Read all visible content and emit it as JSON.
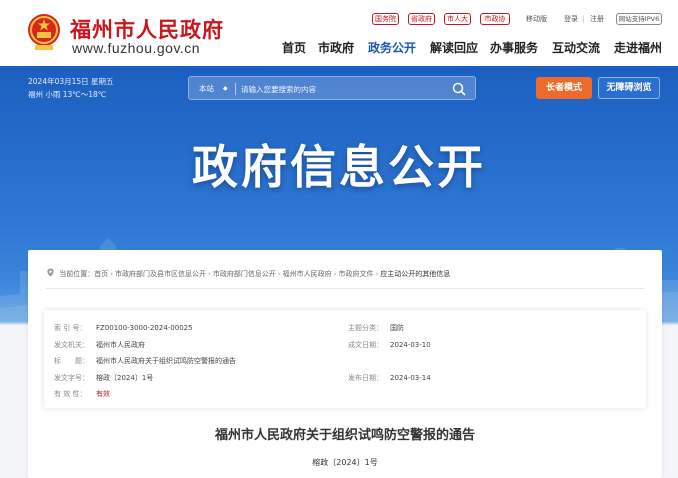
{
  "header": {
    "site_name": "福州市人民政府",
    "site_url": "www.fuzhou.gov.cn",
    "top_links": [
      "国务院",
      "省政府",
      "市人大",
      "市政协"
    ],
    "utility_links": [
      "移动版",
      "登录",
      "|",
      "注册"
    ],
    "ipv6_badge": "网站支持IPV6",
    "nav": [
      "首页",
      "市政府",
      "政务公开",
      "解读回应",
      "办事服务",
      "互动交流",
      "走进福州"
    ],
    "active_nav": "政务公开",
    "accent_color": "#c8161d",
    "active_color": "#1a57b5"
  },
  "banner": {
    "date": "2024年03月15日 星期五",
    "weather": "福州 小雨 13℃～18℃",
    "search_scope": "本站",
    "search_placeholder": "请输入您要搜索的内容",
    "elder_mode": "长者模式",
    "accessibility": "无障碍浏览",
    "hero_title": "政府信息公开",
    "elder_color": "#ee6a2a"
  },
  "breadcrumb": {
    "prefix": "当前位置：",
    "items": [
      "首页",
      "市政府部门及县市区信息公开",
      "市政府部门信息公开",
      "福州市人民政府",
      "市政府文件",
      "应主动公开的其他信息"
    ]
  },
  "meta": {
    "index_label": "索 引 号：",
    "index_value": "FZ00100-3000-2024-00025",
    "category_label": "主题分类：",
    "category_value": "国防",
    "issuer_label": "发文机关：",
    "issuer_value": "福州市人民政府",
    "date_label": "成文日期：",
    "date_value": "2024-03-10",
    "title_label": "标　　题：",
    "title_value": "福州市人民政府关于组织试鸣防空警报的通告",
    "docno_label": "发文字号：",
    "docno_value": "榕政〔2024〕1号",
    "pubdate_label": "发布日期：",
    "pubdate_value": "2024-03-14",
    "validity_label": "有 效 性：",
    "validity_value": "有效"
  },
  "document": {
    "title": "福州市人民政府关于组织试鸣防空警报的通告",
    "number": "榕政〔2024〕1号"
  }
}
